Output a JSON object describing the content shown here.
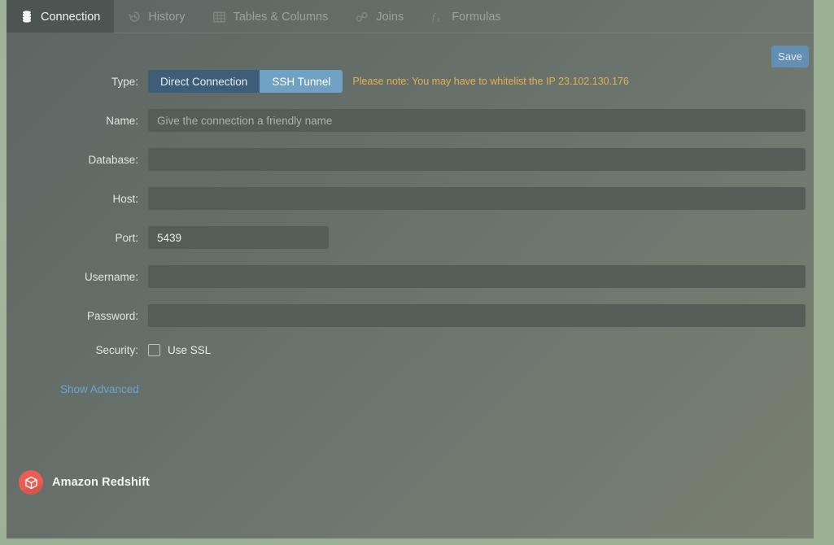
{
  "tabs": [
    {
      "label": "Connection",
      "icon": "database-icon",
      "active": true
    },
    {
      "label": "History",
      "icon": "history-icon",
      "active": false
    },
    {
      "label": "Tables & Columns",
      "icon": "grid-icon",
      "active": false
    },
    {
      "label": "Joins",
      "icon": "link-icon",
      "active": false
    },
    {
      "label": "Formulas",
      "icon": "fx-icon",
      "active": false
    }
  ],
  "toolbar": {
    "save_label": "Save"
  },
  "form": {
    "type": {
      "label": "Type:",
      "options": [
        "Direct Connection",
        "SSH Tunnel"
      ],
      "selected": "SSH Tunnel",
      "note": "Please note: You may have to whitelist the IP 23.102.130.176"
    },
    "name": {
      "label": "Name:",
      "value": "",
      "placeholder": "Give the connection a friendly name"
    },
    "database": {
      "label": "Database:",
      "value": "",
      "placeholder": ""
    },
    "host": {
      "label": "Host:",
      "value": "",
      "placeholder": ""
    },
    "port": {
      "label": "Port:",
      "value": "5439",
      "placeholder": ""
    },
    "username": {
      "label": "Username:",
      "value": "",
      "placeholder": ""
    },
    "password": {
      "label": "Password:",
      "value": "",
      "placeholder": ""
    },
    "security": {
      "label": "Security:",
      "checkbox_label": "Use SSL",
      "checked": false
    },
    "advanced_link": "Show Advanced"
  },
  "brand": {
    "name": "Amazon Redshift",
    "icon": "cube-icon",
    "color": "#eb5c52"
  },
  "colors": {
    "accent_blue": "#6fa1c4",
    "link_blue": "#6ba4d0",
    "note_amber": "#e0b24f",
    "page_bg": "#9cb193",
    "panel_bg": "#666e69",
    "field_bg": "#555d59"
  }
}
